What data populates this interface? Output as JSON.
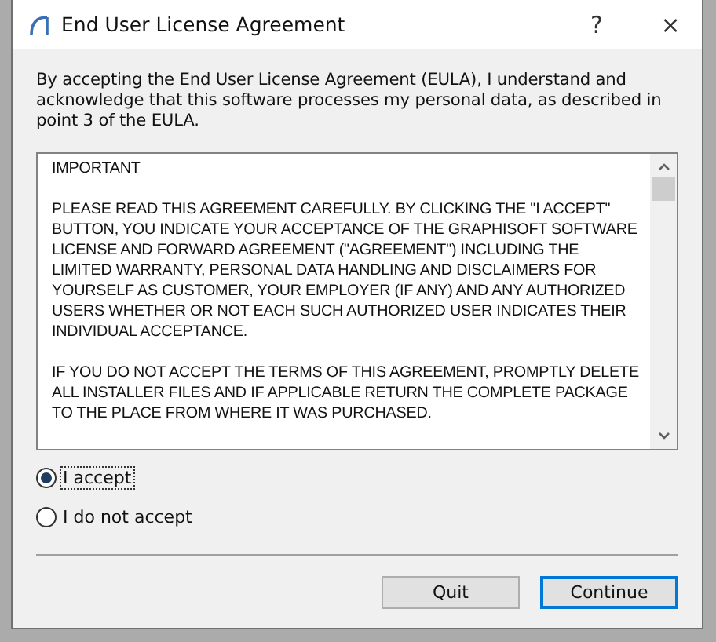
{
  "window": {
    "title": "End User License Agreement",
    "title_buttons": [
      "?",
      "×"
    ]
  },
  "intro": "By accepting the End User License Agreement (EULA), I understand and acknowledge that this software processes my personal data, as described in point 3 of the EULA.",
  "agreement_text": [
    "IMPORTANT",
    "PLEASE READ THIS AGREEMENT CAREFULLY. BY CLICKING THE \"I ACCEPT\" BUTTON, YOU INDICATE YOUR ACCEPTANCE OF THE GRAPHISOFT SOFTWARE LICENSE AND FORWARD AGREEMENT (\"AGREEMENT\") INCLUDING THE LIMITED WARRANTY, PERSONAL DATA HANDLING AND DISCLAIMERS FOR YOURSELF AS CUSTOMER, YOUR EMPLOYER (IF ANY) AND ANY AUTHORIZED USERS WHETHER OR NOT EACH SUCH AUTHORIZED USER INDICATES THEIR INDIVIDUAL ACCEPTANCE.",
    "IF YOU DO NOT ACCEPT THE TERMS OF THIS AGREEMENT, PROMPTLY DELETE ALL INSTALLER FILES AND IF APPLICABLE RETURN THE COMPLETE PACKAGE TO THE PLACE FROM WHERE IT WAS PURCHASED."
  ],
  "options": [
    {
      "label": "I accept",
      "selected": true
    },
    {
      "label": "I do not accept",
      "selected": false
    }
  ],
  "buttons": [
    {
      "label": "Quit",
      "default": false
    },
    {
      "label": "Continue",
      "default": true
    }
  ]
}
